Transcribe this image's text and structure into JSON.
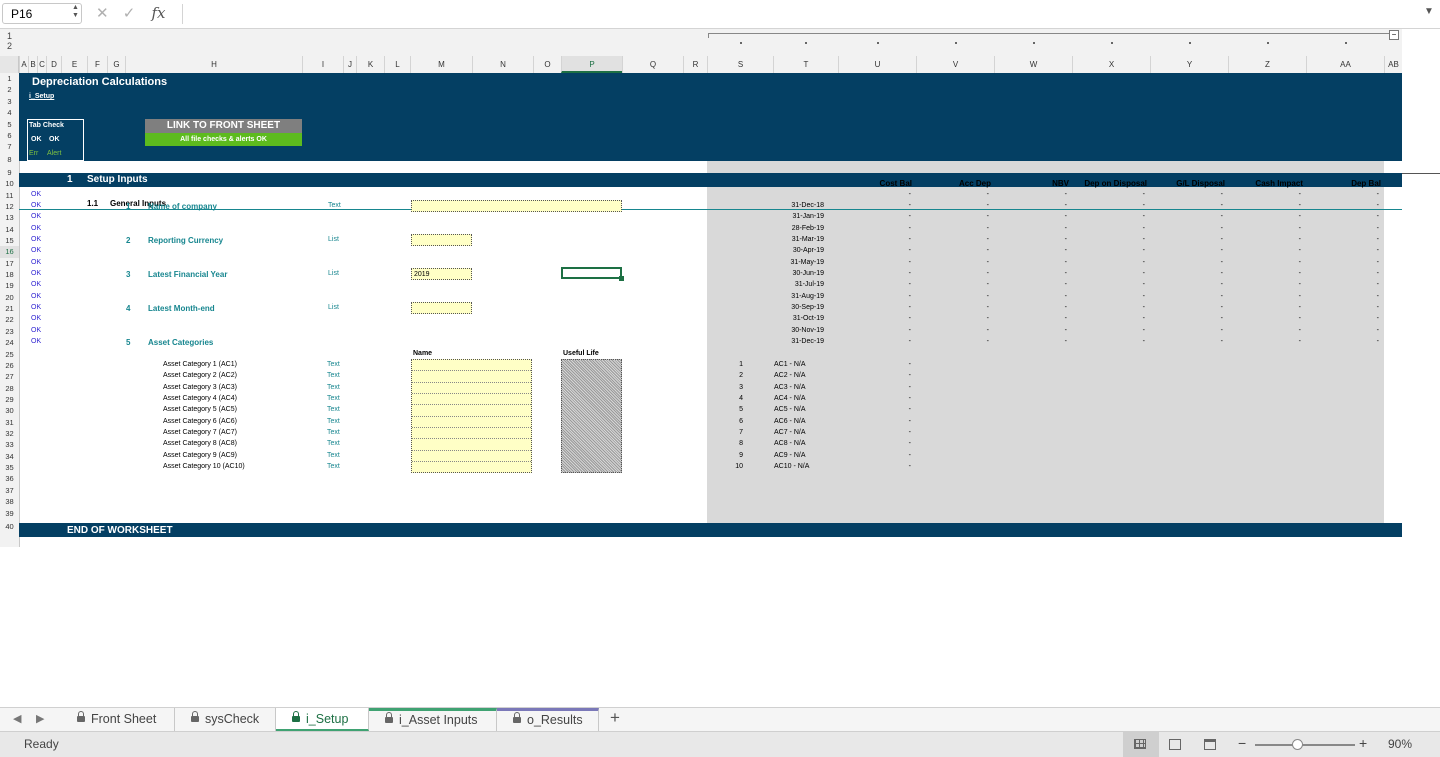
{
  "formula_bar": {
    "name_box": "P16",
    "cancel_icon": "✕",
    "confirm_icon": "✓",
    "fx_label": "fx",
    "formula": ""
  },
  "outline": {
    "levels": [
      "1",
      "2"
    ],
    "collapse_label": "−"
  },
  "columns": [
    "A",
    "B",
    "C",
    "D",
    "E",
    "F",
    "G",
    "H",
    "I",
    "J",
    "K",
    "L",
    "M",
    "N",
    "O",
    "P",
    "Q",
    "R",
    "S",
    "T",
    "U",
    "V",
    "W",
    "X",
    "Y",
    "Z",
    "AA",
    "AB"
  ],
  "selected_column": "P",
  "selected_row": "16",
  "rows": [
    "1",
    "2",
    "3",
    "4",
    "5",
    "6",
    "7",
    "8",
    "9",
    "10",
    "11",
    "12",
    "13",
    "14",
    "15",
    "16",
    "17",
    "18",
    "19",
    "20",
    "21",
    "22",
    "23",
    "24",
    "25",
    "26",
    "27",
    "28",
    "29",
    "30",
    "31",
    "32",
    "33",
    "34",
    "35",
    "36",
    "37",
    "38",
    "39",
    "40"
  ],
  "sheet": {
    "title": "Depreciation Calculations",
    "subtitle": "i_Setup",
    "tab_check": {
      "title": "Tab Check",
      "val1": "OK",
      "val2": "OK",
      "label1": "Err",
      "label2": "Alert"
    },
    "link_button": "LINK TO FRONT SHEET",
    "link_status": "All file checks & alerts OK",
    "section_num": "1",
    "section_title": "Setup Inputs",
    "subsection_num": "1.1",
    "subsection_title": "General Inputs",
    "ok_marks": [
      "OK",
      "OK",
      "OK",
      "OK",
      "OK",
      "OK",
      "OK",
      "OK",
      "OK",
      "OK",
      "OK",
      "OK",
      "OK",
      "OK"
    ],
    "inputs": [
      {
        "num": "1",
        "label": "Name of company",
        "type": "Text",
        "value": ""
      },
      {
        "num": "2",
        "label": "Reporting Currency",
        "type": "List",
        "value": ""
      },
      {
        "num": "3",
        "label": "Latest Financial Year",
        "type": "List",
        "value": "2019"
      },
      {
        "num": "4",
        "label": "Latest Month-end",
        "type": "List",
        "value": ""
      }
    ],
    "asset_section": {
      "num": "5",
      "label": "Asset Categories",
      "name_header": "Name",
      "life_header": "Useful Life"
    },
    "asset_categories": [
      {
        "label": "Asset Category 1 (AC1)",
        "type": "Text"
      },
      {
        "label": "Asset Category 2 (AC2)",
        "type": "Text"
      },
      {
        "label": "Asset Category 3 (AC3)",
        "type": "Text"
      },
      {
        "label": "Asset Category 4 (AC4)",
        "type": "Text"
      },
      {
        "label": "Asset Category 5 (AC5)",
        "type": "Text"
      },
      {
        "label": "Asset Category 6 (AC6)",
        "type": "Text"
      },
      {
        "label": "Asset Category 7 (AC7)",
        "type": "Text"
      },
      {
        "label": "Asset Category 8 (AC8)",
        "type": "Text"
      },
      {
        "label": "Asset Category 9 (AC9)",
        "type": "Text"
      },
      {
        "label": "Asset Category 10 (AC10)",
        "type": "Text"
      }
    ],
    "calc_headers": [
      "Cost Bal",
      "Acc Dep",
      "NBV",
      "Dep on Disposal",
      "G/L Disposal",
      "Cash Impact",
      "Dep Bal"
    ],
    "calc_dates": [
      "31-Dec-18",
      "31-Jan-19",
      "28-Feb-19",
      "31-Mar-19",
      "30-Apr-19",
      "31-May-19",
      "30-Jun-19",
      "31-Jul-19",
      "31-Aug-19",
      "30-Sep-19",
      "31-Oct-19",
      "30-Nov-19",
      "31-Dec-19"
    ],
    "dash": "-",
    "ac_list": [
      {
        "n": "1",
        "code": "AC1 - N/A"
      },
      {
        "n": "2",
        "code": "AC2 - N/A"
      },
      {
        "n": "3",
        "code": "AC3 - N/A"
      },
      {
        "n": "4",
        "code": "AC4 - N/A"
      },
      {
        "n": "5",
        "code": "AC5 - N/A"
      },
      {
        "n": "6",
        "code": "AC6 - N/A"
      },
      {
        "n": "7",
        "code": "AC7 - N/A"
      },
      {
        "n": "8",
        "code": "AC8 - N/A"
      },
      {
        "n": "9",
        "code": "AC9 - N/A"
      },
      {
        "n": "10",
        "code": "AC10 - N/A"
      }
    ],
    "end_label": "END OF WORKSHEET"
  },
  "tabs": [
    {
      "label": "Front Sheet",
      "locked": true
    },
    {
      "label": "sysCheck",
      "locked": true
    },
    {
      "label": "i_Setup",
      "locked": true,
      "active": true
    },
    {
      "label": "i_Asset Inputs",
      "locked": true
    },
    {
      "label": "o_Results",
      "locked": true
    }
  ],
  "add_sheet": "+",
  "status": {
    "text": "Ready",
    "zoom": "90%",
    "zoom_minus": "−",
    "zoom_plus": "+"
  },
  "colors": {
    "navy": "#043f63",
    "teal": "#17868f",
    "link_gray": "#7f7f7f",
    "link_green": "#5dbb1e",
    "input_yellow": "#ffffc6",
    "select_green": "#1d7044"
  }
}
